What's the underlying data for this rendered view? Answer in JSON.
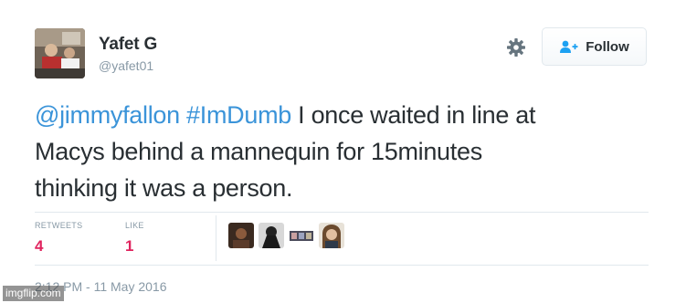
{
  "user": {
    "display_name": "Yafet G",
    "screen_name": "@yafet01"
  },
  "actions": {
    "settings_icon": "gear-icon",
    "follow_icon": "add-user-icon",
    "follow_label": "Follow"
  },
  "tweet": {
    "mention": "@jimmyfallon",
    "hashtag": "#ImDumb",
    "text_line1": " I once waited in line at",
    "text_line2": "Macys behind a mannequin for 15minutes",
    "text_line3": "thinking it was a person."
  },
  "stats": {
    "retweets_label": "RETWEETS",
    "retweets_count": "4",
    "likes_label": "LIKE",
    "likes_count": "1"
  },
  "timestamp": "2:12 PM - 11 May 2016",
  "watermark": "imgflip.com",
  "colors": {
    "link": "#3b94d9",
    "count": "#e0245e",
    "muted": "#8899a6"
  }
}
